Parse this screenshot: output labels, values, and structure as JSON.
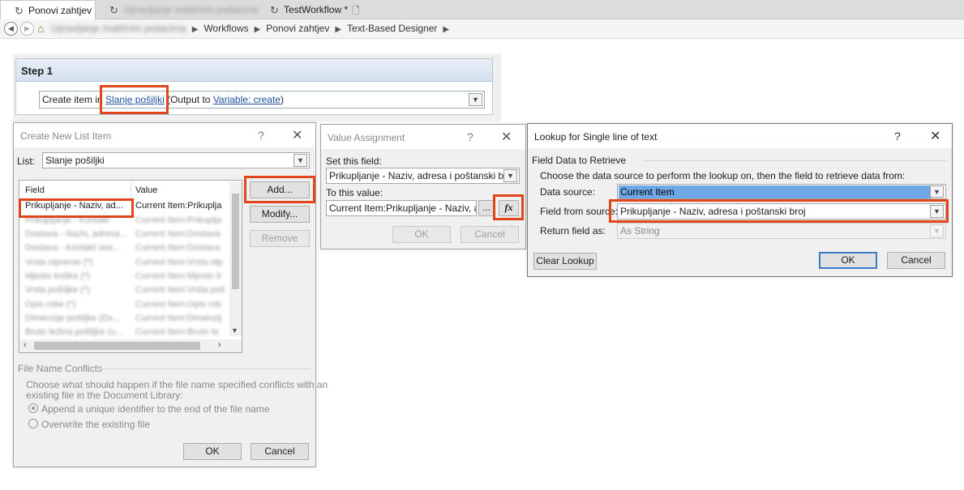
{
  "tabs": [
    {
      "label": "Ponovi zahtjev",
      "active": true,
      "icon": "workflow-icon"
    },
    {
      "label": "Upravljanje matičnim podacima",
      "active": false,
      "icon": "workflow-icon",
      "blurred": true
    },
    {
      "label": "TestWorkflow *",
      "active": false,
      "icon": "workflow-icon"
    }
  ],
  "breadcrumb": {
    "root": "Upravljanje matičnim podacima",
    "items": [
      "Workflows",
      "Ponovi zahtjev",
      "Text-Based Designer"
    ]
  },
  "step": {
    "title": "Step 1",
    "action_prefix": "Create item in",
    "list_link": "Slanje pošiljki",
    "output_prefix": "(Output to",
    "variable_link": "Variable: create",
    "close_paren": ")"
  },
  "create_list_item": {
    "title": "Create New List Item",
    "list_label": "List:",
    "list_value": "Slanje pošiljki",
    "col_field": "Field",
    "col_value": "Value",
    "rows": [
      {
        "field": "Prikupljanje - Naziv, ad...",
        "value": "Current Item:Prikuplja"
      },
      {
        "field": "Prikupljanje - Kontakt",
        "value": "Current Item:Prikuplja"
      },
      {
        "field": "Dostava - Naziv, adresa...",
        "value": "Current Item:Dostava"
      },
      {
        "field": "Dostava - Kontakt oso...",
        "value": "Current Item:Dostava"
      },
      {
        "field": "Vrsta otpreme (*)",
        "value": "Current Item:Vrsta otp"
      },
      {
        "field": "Mjesto troška (*)",
        "value": "Current Item:Mjesto tr"
      },
      {
        "field": "Vrsta pošiljke (*)",
        "value": "Current Item:Vrsta poš"
      },
      {
        "field": "Opis robe (*)",
        "value": "Current Item:Opis rob"
      },
      {
        "field": "Dimenzije pošiljke (Dx...",
        "value": "Current Item:Dimenzij"
      },
      {
        "field": "Bruto težina pošiljke (u...",
        "value": "Current Item:Bruto te"
      }
    ],
    "add_label": "Add...",
    "modify_label": "Modify...",
    "remove_label": "Remove",
    "conflicts_title": "File Name Conflicts",
    "conflicts_desc_1": "Choose what should happen if the file name specified conflicts with an",
    "conflicts_desc_2": "existing file in the Document Library:",
    "option_unique": "Append a unique identifier to the end of the file name",
    "option_overwrite": "Overwrite the existing file",
    "ok_label": "OK",
    "cancel_label": "Cancel"
  },
  "value_assignment": {
    "title": "Value Assignment",
    "set_label": "Set this field:",
    "set_value": "Prikupljanje - Naziv, adresa i poštanski broj",
    "to_label": "To this value:",
    "to_value": "Current Item:Prikupljanje - Naziv, adre",
    "browse_label": "...",
    "fx_label": "fx",
    "ok_label": "OK",
    "cancel_label": "Cancel"
  },
  "lookup": {
    "title": "Lookup for Single line of text",
    "group_title": "Field Data to Retrieve",
    "instructions": "Choose the data source to perform the lookup on, then the field to retrieve data from:",
    "source_label": "Data source:",
    "source_value": "Current Item",
    "field_label": "Field from source:",
    "field_value": "Prikupljanje - Naziv, adresa i poštanski broj",
    "return_label": "Return field as:",
    "return_value": "As String",
    "clear_label": "Clear Lookup",
    "ok_label": "OK",
    "cancel_label": "Cancel"
  },
  "colors": {
    "highlight": "#e0461c",
    "link": "#2050a0",
    "selection": "#6fa8e6"
  }
}
